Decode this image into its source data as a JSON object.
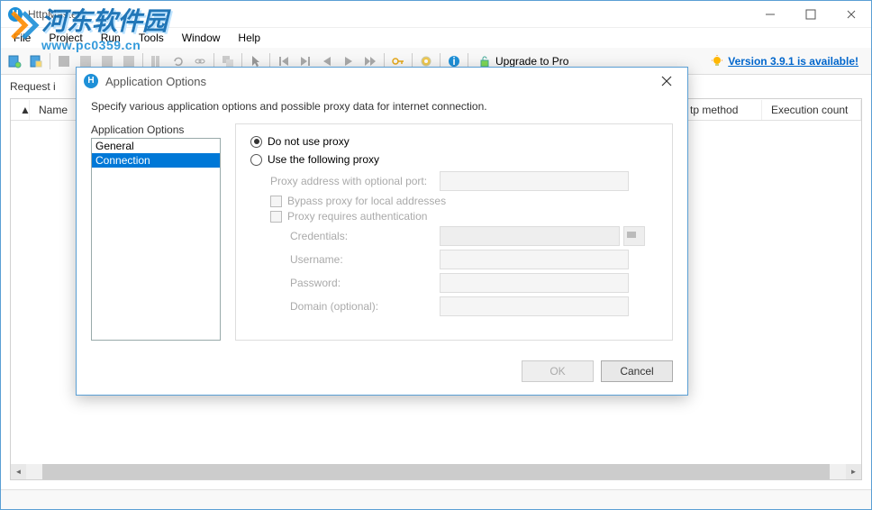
{
  "main": {
    "title": "HttpMaster",
    "menus": [
      "File",
      "Project",
      "Run",
      "Tools",
      "Window",
      "Help"
    ],
    "toolbar_icons": [
      "new-project-icon",
      "open-project-icon",
      "save-icon",
      "add-icon",
      "properties-icon",
      "disk-icon",
      "columns-icon",
      "refresh-icon",
      "link-icon",
      "clone-icon",
      "pointer-icon",
      "step-back-icon",
      "step-fwd-icon",
      "play-icon",
      "play-all-icon",
      "fast-fwd-icon",
      "key-icon",
      "gear-icon",
      "info-icon"
    ],
    "upgrade": {
      "icon": "unlock-icon",
      "label": "Upgrade to Pro"
    },
    "version": {
      "icon": "bulb-icon",
      "label": "Version 3.9.1 is available!"
    },
    "request_label": "Request i",
    "columns": {
      "sort": "▲",
      "name": "Name",
      "http_method": "tp method",
      "exec_count": "Execution count"
    }
  },
  "modal": {
    "title": "Application Options",
    "desc": "Specify various application options and possible proxy data for internet connection.",
    "tree_label": "Application Options",
    "tree_items": [
      "General",
      "Connection"
    ],
    "proxy": {
      "no_proxy_label": "Do not use proxy",
      "use_proxy_label": "Use the following proxy",
      "addr_label": "Proxy address with optional port:",
      "bypass_label": "Bypass proxy for local addresses",
      "auth_label": "Proxy requires authentication",
      "cred_label": "Credentials:",
      "user_label": "Username:",
      "pass_label": "Password:",
      "domain_label": "Domain (optional):"
    },
    "buttons": {
      "ok": "OK",
      "cancel": "Cancel"
    }
  },
  "watermark": {
    "cn": "河东软件园",
    "url": "www.pc0359.cn"
  }
}
